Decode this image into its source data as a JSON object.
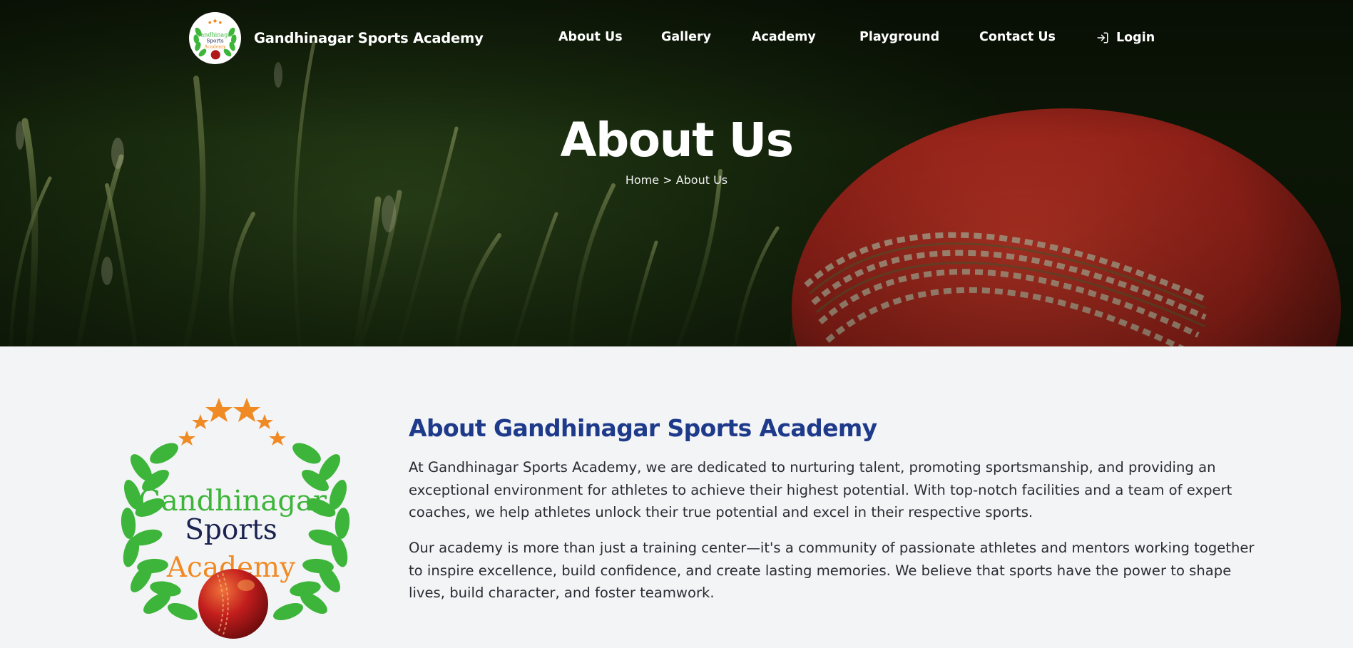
{
  "brand": {
    "name": "Gandhinagar Sports Academy",
    "logo_text_line1": "Gandhinagar",
    "logo_text_line2": "Sports",
    "logo_text_line3": "Academy"
  },
  "nav": {
    "items": [
      {
        "label": "About Us"
      },
      {
        "label": "Gallery"
      },
      {
        "label": "Academy"
      },
      {
        "label": "Playground"
      },
      {
        "label": "Contact Us"
      }
    ],
    "login_label": "Login",
    "login_icon": "login-icon"
  },
  "hero": {
    "title": "About Us",
    "breadcrumb_home": "Home",
    "breadcrumb_sep": ">",
    "breadcrumb_current": "About Us"
  },
  "about": {
    "heading": "About Gandhinagar Sports Academy",
    "paragraph_1": "At Gandhinagar Sports Academy, we are dedicated to nurturing talent, promoting sportsmanship, and providing an exceptional environment for athletes to achieve their highest potential. With top-notch facilities and a team of expert coaches, we help athletes unlock their true potential and excel in their respective sports.",
    "paragraph_2": "Our academy is more than just a training center—it's a community of passionate athletes and mentors working together to inspire excellence, build confidence, and create lasting memories. We believe that sports have the power to shape lives, build character, and foster teamwork."
  },
  "colors": {
    "heading_blue": "#1e3a8a",
    "laurel_green": "#3db53a",
    "star_orange": "#f08a24",
    "ball_red": "#b0181a",
    "text": "#2b2b33"
  }
}
